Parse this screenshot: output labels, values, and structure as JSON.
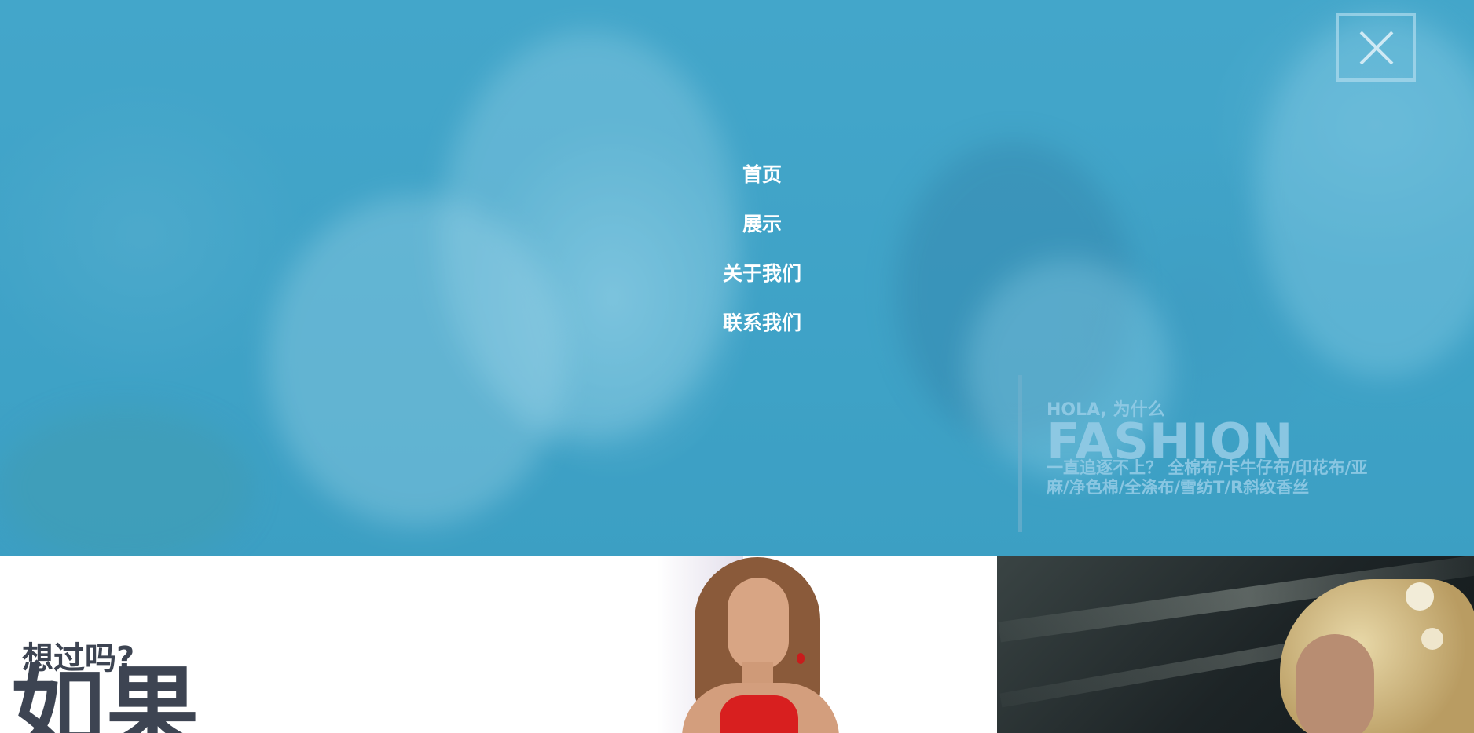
{
  "nav": {
    "items": [
      {
        "label": "首页"
      },
      {
        "label": "展示"
      },
      {
        "label": "关于我们"
      },
      {
        "label": "联系我们"
      }
    ]
  },
  "close_button": {
    "icon": "close-icon"
  },
  "hero_caption": {
    "kicker": "HOLA, 为什么",
    "headline": "FASHION",
    "body": "一直追逐不上？ 全棉布/卡牛仔布/印花布/亚麻/净色棉/全涤布/雪纺T/R斜纹香丝"
  },
  "promo": {
    "question": "想过吗?",
    "big_word": "如果"
  },
  "colors": {
    "hero_overlay": "#3fa2c6",
    "nav_text": "#ffffff",
    "caption_text": "#96cde6",
    "promo_text": "#3d4452"
  }
}
